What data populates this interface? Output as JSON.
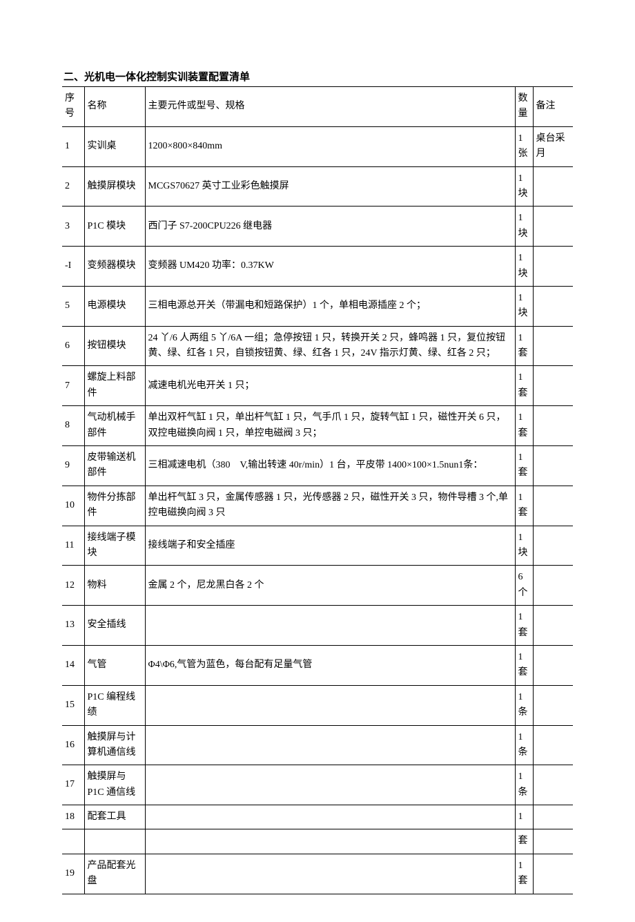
{
  "title": "二、光机电一体化控制实训装置配置清单",
  "headers": {
    "seq": "序号",
    "name": "名称",
    "spec": "主要元件或型号、规格",
    "qty": "数量",
    "note": "备注"
  },
  "rows": [
    {
      "seq": "1",
      "name": "实训桌",
      "spec": "1200×800×840mm",
      "qty": "1张",
      "note": "桌台采月"
    },
    {
      "seq": "2",
      "name": "触摸屏模块",
      "spec": "MCGS70627 英寸工业彩色触摸屏",
      "qty": "1块",
      "note": ""
    },
    {
      "seq": "3",
      "name": "P1C 模块",
      "spec": "西门子 S7-200CPU226 继电器",
      "qty": "1块",
      "note": ""
    },
    {
      "seq": "-I",
      "name": "变频器模块",
      "spec": "变频器 UM420 功率：0.37KW",
      "qty": "1块",
      "note": ""
    },
    {
      "seq": "5",
      "name": "电源模块",
      "spec": "三相电源总开关（带漏电和短路保护）1 个，单相电源插座 2 个；",
      "qty": "1块",
      "note": ""
    },
    {
      "seq": "6",
      "name": "按钮模块",
      "spec": "24 丫/6 人两组 5 丫/6A 一组；急停按钮 1 只，转换开关 2 只，蜂鸣器 1 只，复位按钮黄、绿、红各 1 只，自锁按钮黄、绿、红各 1 只，24V 指示灯黄、绿、红各 2 只；",
      "qty": "1套",
      "note": ""
    },
    {
      "seq": "7",
      "name": "螺旋上料部件",
      "spec": "减速电机光电开关 1 只；",
      "qty": "1套",
      "note": ""
    },
    {
      "seq": "8",
      "name": "气动机械手部件",
      "spec": "单出双杆气缸 1 只，单出杆气缸 1 只，气手爪 1 只，旋转气缸 1 只，磁性开关 6 只，双控电磁换向阀 1 只，单控电磁阀 3 只；",
      "qty": "1套",
      "note": ""
    },
    {
      "seq": "9",
      "name": "皮带输送机部件",
      "spec": "三相减速电机（380　V,输出转速 40r/min）1 台，平皮带 1400×100×1.5nun1条：",
      "qty": "1套",
      "note": ""
    },
    {
      "seq": "10",
      "name": "物件分拣部件",
      "spec": "单出杆气缸 3 只，金属传感器 1 只，光传感器 2 只，磁性开关 3 只，物件导槽 3 个,单控电磁换向阀 3 只",
      "qty": "1套",
      "note": ""
    },
    {
      "seq": "11",
      "name": "接线端子模块",
      "spec": "接线端子和安全插座",
      "qty": "1块",
      "note": ""
    },
    {
      "seq": "12",
      "name": "物料",
      "spec": "金属 2 个，尼龙黑白各 2 个",
      "qty": "6个",
      "note": ""
    },
    {
      "seq": "13",
      "name": "安全插线",
      "spec": "",
      "qty": "1套",
      "note": ""
    },
    {
      "seq": "14",
      "name": "气管",
      "spec": "Φ4\\Φ6,气管为蓝色，每台配有足量气管",
      "qty": "1套",
      "note": ""
    },
    {
      "seq": "15",
      "name": "P1C 编程线绩",
      "spec": "",
      "qty": "1条",
      "note": ""
    },
    {
      "seq": "16",
      "name": "触摸屏与计算机通信线",
      "spec": "",
      "qty": "1条",
      "note": ""
    },
    {
      "seq": "17",
      "name": "触摸屏与P1C 通信线",
      "spec": "",
      "qty": "1条",
      "note": ""
    },
    {
      "seq": "18",
      "name": "配套工具",
      "spec": "",
      "qty": "1",
      "note": ""
    },
    {
      "seq": "",
      "name": "",
      "spec": "",
      "qty": "套",
      "note": ""
    },
    {
      "seq": "19",
      "name": "产品配套光盘",
      "spec": "",
      "qty": "1套",
      "note": ""
    }
  ]
}
